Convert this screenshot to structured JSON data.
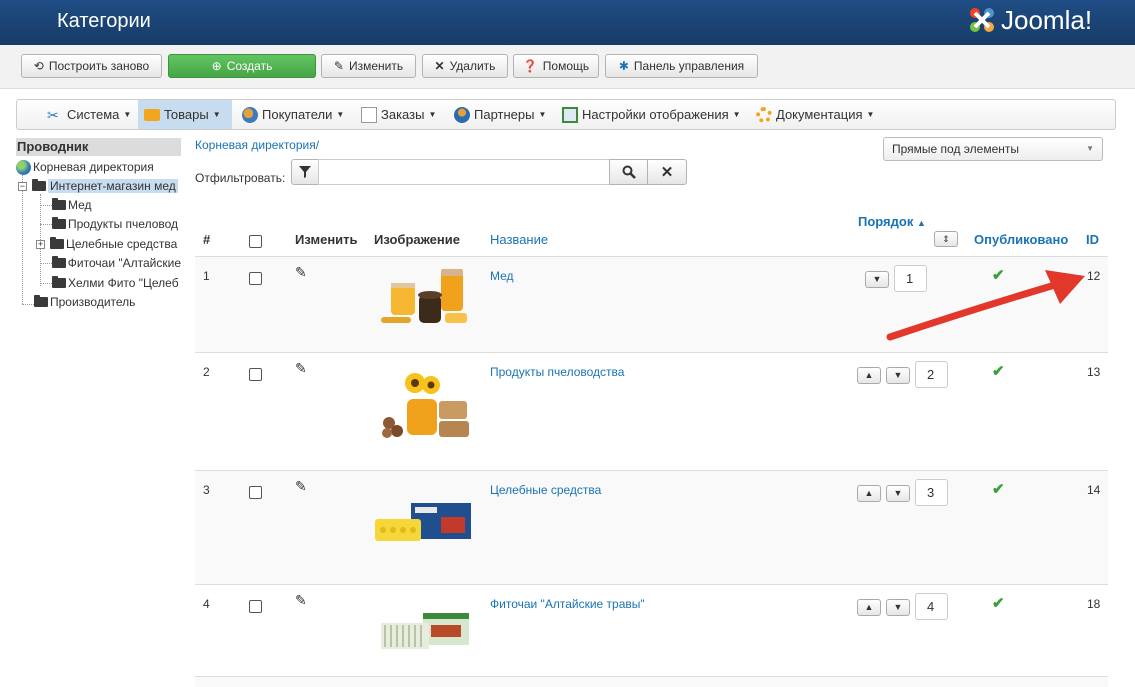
{
  "header": {
    "title": "Категории",
    "logo_text": "Joomla!"
  },
  "toolbar": {
    "rebuild": "Построить заново",
    "create": "Создать",
    "edit": "Изменить",
    "delete": "Удалить",
    "help": "Помощь",
    "control_panel": "Панель управления"
  },
  "menu": {
    "items": [
      {
        "label": "Система",
        "icon": "tools-icon"
      },
      {
        "label": "Товары",
        "icon": "box-icon"
      },
      {
        "label": "Покупатели",
        "icon": "users-icon"
      },
      {
        "label": "Заказы",
        "icon": "orders-icon"
      },
      {
        "label": "Партнеры",
        "icon": "partners-icon"
      },
      {
        "label": "Настройки отображения",
        "icon": "display-icon"
      },
      {
        "label": "Документация",
        "icon": "help-ring-icon"
      }
    ],
    "active_index": 1
  },
  "sidebar": {
    "title": "Проводник",
    "root": "Корневая директория",
    "shop": "Интернет-магазин мед",
    "children": [
      "Мед",
      "Продукты пчеловод",
      "Целебные средства",
      "Фиточаи \"Алтайские",
      "Хелми Фито \"Целеб"
    ],
    "manufacturer": "Производитель"
  },
  "main": {
    "breadcrumb": "Корневая директория/",
    "filter_label": "Отфильтровать:",
    "filter_value": "",
    "view_select": "Прямые под элементы"
  },
  "table": {
    "headers": {
      "num": "#",
      "edit": "Изменить",
      "image": "Изображение",
      "name": "Название",
      "order": "Порядок",
      "published": "Опубликовано",
      "id": "ID"
    },
    "rows": [
      {
        "num": "1",
        "name": "Мед",
        "order": "1",
        "id": "12"
      },
      {
        "num": "2",
        "name": "Продукты пчеловодства",
        "order": "2",
        "id": "13"
      },
      {
        "num": "3",
        "name": "Целебные средства",
        "order": "3",
        "id": "14"
      },
      {
        "num": "4",
        "name": "Фиточаи \"Алтайские травы\"",
        "order": "4",
        "id": "18"
      }
    ]
  },
  "colors": {
    "header_bg": "#1f4d85",
    "link": "#1a73b5",
    "create_green": "#46a546",
    "check_green": "#3a9f3a",
    "arrow_red": "#e2372b"
  }
}
